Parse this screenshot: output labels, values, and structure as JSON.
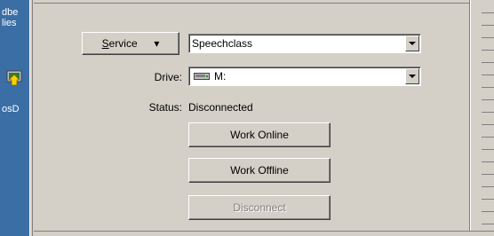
{
  "desktop": {
    "icon_texts": [
      "dbe",
      "lies",
      "osD"
    ],
    "icon": "network-drive-icon"
  },
  "service": {
    "button_label_underlined": "S",
    "button_label_rest": "ervice",
    "button_arrow": "▾",
    "value": "Speechclass"
  },
  "drive": {
    "label": "Drive:",
    "value": "M:",
    "icon": "drive-icon"
  },
  "status": {
    "label": "Status:",
    "value": "Disconnected"
  },
  "buttons": {
    "work_online": "Work Online",
    "work_offline": "Work Offline",
    "disconnect": "Disconnect"
  },
  "colors": {
    "desktop": "#3a6ea5",
    "face": "#d4d0c8"
  }
}
